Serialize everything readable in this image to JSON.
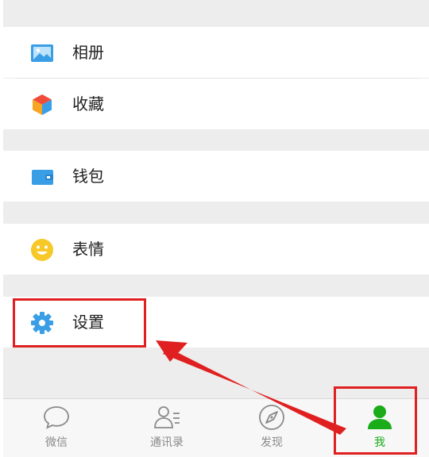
{
  "menu": {
    "items": [
      {
        "label": "相册",
        "icon": "photo-album-icon"
      },
      {
        "label": "收藏",
        "icon": "favorites-cube-icon"
      },
      {
        "label": "钱包",
        "icon": "wallet-icon"
      },
      {
        "label": "表情",
        "icon": "emoji-smiley-icon"
      },
      {
        "label": "设置",
        "icon": "settings-gear-icon"
      }
    ]
  },
  "tabbar": {
    "tabs": [
      {
        "label": "微信",
        "icon": "chat-bubble-icon",
        "active": false
      },
      {
        "label": "通讯录",
        "icon": "contacts-icon",
        "active": false
      },
      {
        "label": "发现",
        "icon": "compass-icon",
        "active": false
      },
      {
        "label": "我",
        "icon": "me-person-icon",
        "active": true
      }
    ]
  },
  "colors": {
    "accent_green": "#1aad19",
    "annotation_red": "#e02020",
    "icon_blue": "#3a9ee6",
    "emoji_yellow": "#f6c828"
  }
}
